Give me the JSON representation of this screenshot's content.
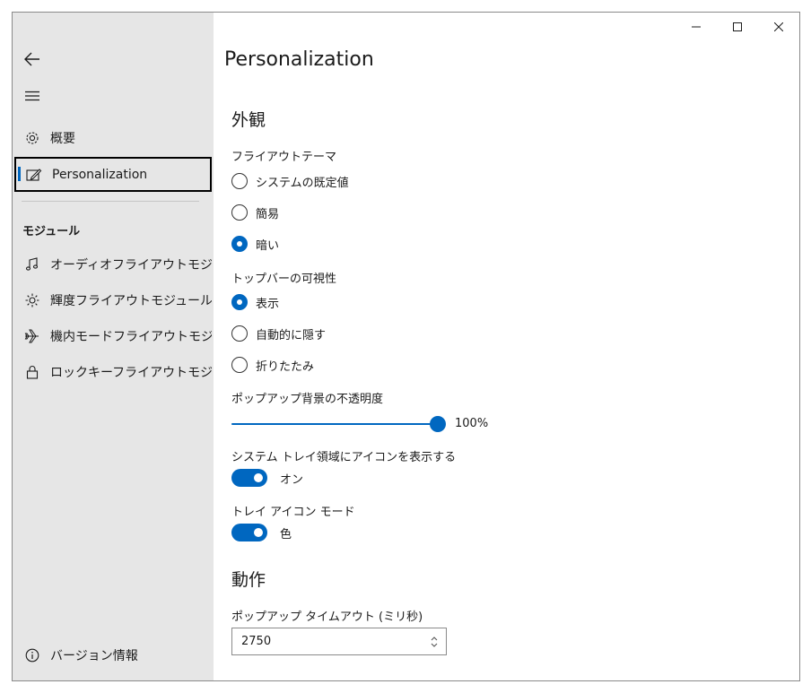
{
  "window": {
    "controls": {
      "minimize": "minimize-icon",
      "maximize": "maximize-icon",
      "close": "close-icon"
    }
  },
  "sidebar": {
    "back_icon": "back-arrow-icon",
    "menu_icon": "hamburger-icon",
    "items": [
      {
        "label": "概要",
        "icon": "gear-icon"
      },
      {
        "label": "Personalization",
        "icon": "pen-window-icon",
        "selected": true
      }
    ],
    "group_header": "モジュール",
    "modules": [
      {
        "label": "オーディオフライアウトモジュール",
        "icon": "music-note-icon"
      },
      {
        "label": "輝度フライアウトモジュール",
        "icon": "brightness-icon"
      },
      {
        "label": "機内モードフライアウトモジュール",
        "icon": "airplane-icon"
      },
      {
        "label": "ロックキーフライアウトモジュール",
        "icon": "lock-icon"
      }
    ],
    "footer": {
      "label": "バージョン情報",
      "icon": "info-icon"
    }
  },
  "page": {
    "title": "Personalization",
    "appearance": {
      "header": "外観",
      "flyout_theme": {
        "label": "フライアウトテーマ",
        "options": [
          "システムの既定値",
          "簡易",
          "暗い"
        ],
        "selected": 2
      },
      "topbar_visibility": {
        "label": "トップバーの可視性",
        "options": [
          "表示",
          "自動的に隠す",
          "折りたたみ"
        ],
        "selected": 0
      },
      "popup_opacity": {
        "label": "ポップアップ背景の不透明度",
        "value": 100,
        "value_text": "100%"
      },
      "tray_icon": {
        "label": "システム トレイ領域にアイコンを表示する",
        "state": "オン",
        "on": true
      },
      "tray_icon_mode": {
        "label": "トレイ アイコン モード",
        "state": "色",
        "on": true
      }
    },
    "behavior": {
      "header": "動作",
      "popup_timeout": {
        "label": "ポップアップ タイムアウト (ミリ秒)",
        "value": "2750"
      }
    }
  },
  "colors": {
    "accent": "#0067c0",
    "sidebar_bg": "#e6e6e6",
    "content_bg": "#ffffff"
  }
}
